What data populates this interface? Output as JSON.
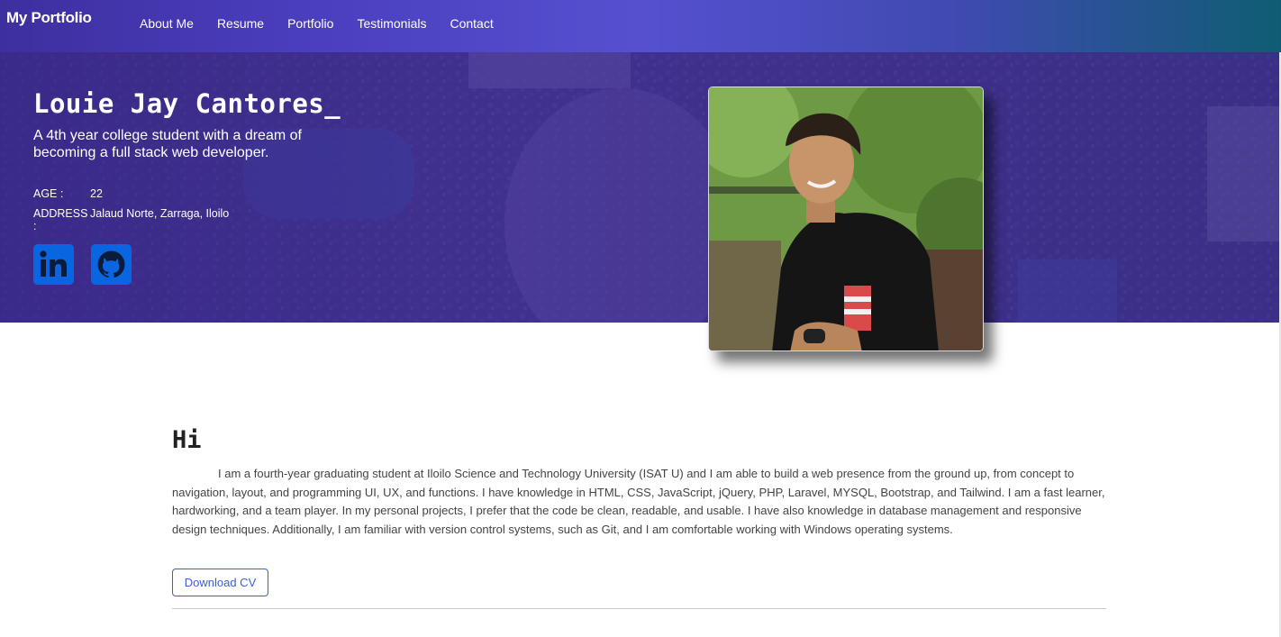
{
  "navbar": {
    "brand": "My Portfolio",
    "links": [
      "About Me",
      "Resume",
      "Portfolio",
      "Testimonials",
      "Contact"
    ]
  },
  "hero": {
    "name": "Louie Jay Cantores_",
    "tagline": "A 4th year college student with a dream of becoming a full stack web developer.",
    "age_label": "AGE :",
    "age_value": "22",
    "address_label": "ADDRESS :",
    "address_value": "Jalaud Norte, Zarraga, Iloilo",
    "social": [
      {
        "icon": "linkedin-icon"
      },
      {
        "icon": "github-icon"
      }
    ]
  },
  "about": {
    "heading": "Hi",
    "paragraph": "I am a fourth-year graduating student at Iloilo Science and Technology University (ISAT U) and I am able to build a web presence from the ground up, from concept to navigation, layout, and programming UI, UX, and functions. I have knowledge in HTML, CSS, JavaScript, jQuery, PHP, Laravel, MYSQL, Bootstrap, and Tailwind. I am a fast learner, hardworking, and a team player. In my personal projects, I prefer that the code be clean, readable, and usable. I have also knowledge in database management and responsive design techniques. Additionally, I am familiar with version control systems, such as Git, and I am comfortable working with Windows operating systems.",
    "download_label": "Download CV"
  },
  "colors": {
    "accent": "#3b5fd1",
    "social_blue": "#0a66e0",
    "hero_purple": "#3a2c7a"
  }
}
